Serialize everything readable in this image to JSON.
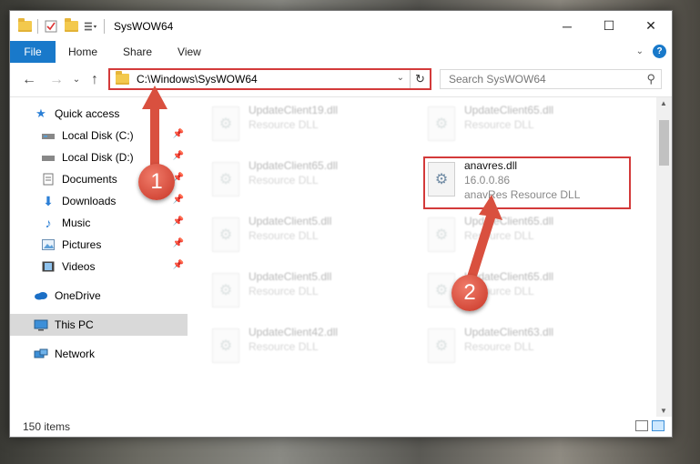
{
  "window": {
    "title": "SysWOW64",
    "controls": {
      "minimize": "─",
      "maximize": "☐",
      "close": "✕"
    }
  },
  "ribbon": {
    "file_tab": "File",
    "tabs": [
      "Home",
      "Share",
      "View"
    ]
  },
  "nav": {
    "address_path": "C:\\Windows\\SysWOW64",
    "search_placeholder": "Search SysWOW64"
  },
  "sidebar": {
    "items": [
      {
        "label": "Quick access",
        "icon": "star-icon"
      },
      {
        "label": "Local Disk (C:)",
        "icon": "drive-icon",
        "pinned": true
      },
      {
        "label": "Local Disk (D:)",
        "icon": "drive-icon",
        "pinned": true
      },
      {
        "label": "Documents",
        "icon": "documents-icon",
        "pinned": true
      },
      {
        "label": "Downloads",
        "icon": "download-icon",
        "pinned": true
      },
      {
        "label": "Music",
        "icon": "music-icon",
        "pinned": true
      },
      {
        "label": "Pictures",
        "icon": "pictures-icon",
        "pinned": true
      },
      {
        "label": "Videos",
        "icon": "videos-icon",
        "pinned": true
      },
      {
        "label": "OneDrive",
        "icon": "cloud-icon"
      },
      {
        "label": "This PC",
        "icon": "computer-icon",
        "selected": true
      },
      {
        "label": "Network",
        "icon": "network-icon"
      }
    ]
  },
  "files": [
    {
      "name": "UpdateClient19.dll",
      "sub": "Resource DLL"
    },
    {
      "name": "UpdateClient65.dll",
      "sub": "Resource DLL"
    },
    {
      "name": "UpdateClient65.dll",
      "sub": "Resource DLL"
    },
    {
      "name": "anavres.dll",
      "version": "16.0.0.86",
      "sub": "anavRes Resource DLL",
      "highlighted": true
    },
    {
      "name": "UpdateClient5.dll",
      "sub": "Resource DLL"
    },
    {
      "name": "UpdateClient65.dll",
      "sub": "Resource DLL"
    },
    {
      "name": "UpdateClient5.dll",
      "sub": "Resource DLL"
    },
    {
      "name": "UpdateClient65.dll",
      "sub": "Resource DLL"
    },
    {
      "name": "UpdateClient42.dll",
      "sub": "Resource DLL"
    },
    {
      "name": "UpdateClient63.dll",
      "sub": "Resource DLL"
    }
  ],
  "status": {
    "item_count": "150 items"
  },
  "markers": {
    "one": "1",
    "two": "2"
  },
  "colors": {
    "accent": "#1979ca",
    "highlight": "#d33a3a",
    "marker": "#d44a3a"
  }
}
